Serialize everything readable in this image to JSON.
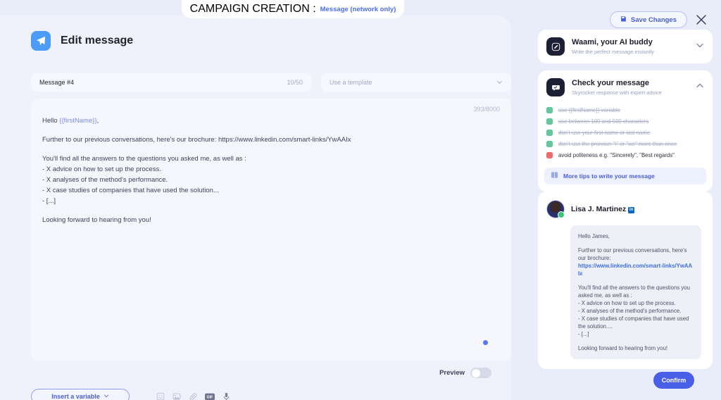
{
  "banner": {
    "label": "CAMPAIGN CREATION :",
    "value": "Message (network only)"
  },
  "topbar": {
    "save_label": "Save Changes",
    "save_icon": "save-disk-icon",
    "close_icon": "close-icon"
  },
  "editor": {
    "icon": "send-paper-plane-icon",
    "title": "Edit message",
    "message_name_value": "Message #4",
    "message_name_count": "10/50",
    "template_placeholder": "Use a template",
    "template_chevron": "chevron-down-icon",
    "char_count": "393/8000",
    "body": {
      "greeting_prefix": "Hello ",
      "greeting_variable": "{{firstName}}",
      "greeting_suffix": ",",
      "paragraph_2": "Further to our previous conversations, here's our brochure: https://www.linkedin.com/smart-links/YwAAIx",
      "paragraph_3_intro": "You'll find all the answers to the questions you asked me, as well as :",
      "bullets": [
        "- X advice on how to set up the process.",
        "- X analyses of the method's performance.",
        "- X case studies of companies that have used the solution...",
        "- [...]"
      ],
      "closing": "Looking forward to hearing from you!"
    },
    "preview_label": "Preview",
    "preview_toggle_state": "off",
    "insert_variable_label": "Insert a variable",
    "insert_variable_chevron": "chevron-down-icon",
    "tool_icons": [
      "emoji-icon",
      "image-icon",
      "attachment-paperclip-icon",
      "gif-icon",
      "microphone-icon"
    ]
  },
  "assistant_card": {
    "icon": "pencil-square-icon",
    "title": "Waami, your AI buddy",
    "subtitle": "Write the perfect message instantly",
    "chevron": "chevron-down-icon"
  },
  "check_card": {
    "icon": "chat-bubble-check-icon",
    "title": "Check your message",
    "subtitle": "Skyrocket response with expert advice",
    "chevron": "chevron-up-icon",
    "items": [
      {
        "label": "use {{firstName}} variable",
        "status": "ok"
      },
      {
        "label": "use between 100 and 500 characters",
        "status": "ok"
      },
      {
        "label": "don't use your first name or last name",
        "status": "ok"
      },
      {
        "label": "don't use the pronoun \"I\" or \"we\" more than once",
        "status": "ok"
      },
      {
        "label": "avoid politeness e.g. \"Sincerely\", \"Best regards\"",
        "status": "bad"
      }
    ],
    "more_tips_label": "More tips to write your message",
    "more_tips_icon": "book-icon"
  },
  "preview_card": {
    "avatar": "user-avatar",
    "name": "Lisa J. Martinez",
    "badge_icon": "linkedin-badge-icon",
    "badge_text": "in",
    "message": {
      "greeting": "Hello James,",
      "paragraph_2_text": "Further to our previous conversations, here's our brochure:",
      "link": "https://www.linkedin.com/smart-links/YwAAIx",
      "paragraph_3_intro": "You'll find all the answers to the questions you asked me, as well as :",
      "bullets": [
        "- X advice on how to set up the process.",
        "- X analyses of the method's performance.",
        "- X case studies of companies that have used the solution....",
        "- [...]"
      ],
      "closing": "Looking forward to hearing from you!"
    }
  },
  "footer": {
    "confirm_label": "Confirm"
  },
  "colors": {
    "background": "#e9ecf9",
    "card": "#ffffff",
    "accent": "#4a5fe8",
    "link": "#4a6cf7",
    "ok": "#63c79b",
    "bad": "#ef6b6b"
  }
}
